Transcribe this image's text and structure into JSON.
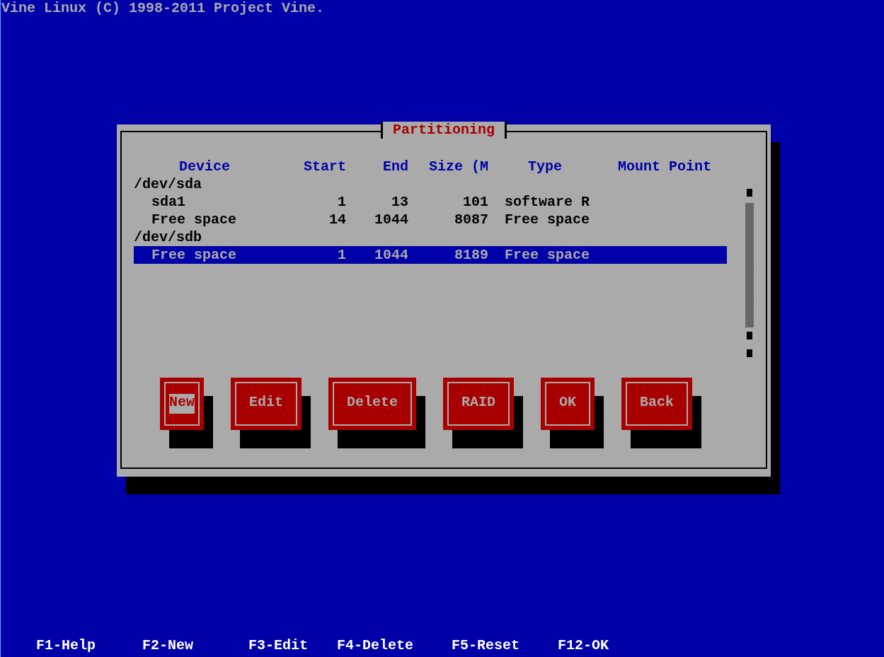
{
  "header": "Vine Linux (C) 1998-2011 Project Vine.",
  "dialog": {
    "title": "Partitioning",
    "columns": [
      "Device",
      "Start",
      "End",
      "Size (M",
      "Type",
      "Mount Point"
    ],
    "disks": [
      {
        "device": "/dev/sda",
        "selected": false,
        "children": [
          {
            "device": "sda1",
            "start": "1",
            "end": "13",
            "size": "101",
            "type": "software R",
            "selected": false
          },
          {
            "device": "Free space",
            "start": "14",
            "end": "1044",
            "size": "8087",
            "type": "Free space",
            "selected": false
          }
        ]
      },
      {
        "device": "/dev/sdb",
        "selected": false,
        "children": [
          {
            "device": "Free space",
            "start": "1",
            "end": "1044",
            "size": "8189",
            "type": "Free space",
            "selected": true
          }
        ]
      }
    ],
    "buttons": [
      {
        "label": "New",
        "selected": true
      },
      {
        "label": "Edit",
        "selected": false
      },
      {
        "label": "Delete",
        "selected": false
      },
      {
        "label": "RAID",
        "selected": false
      },
      {
        "label": "OK",
        "selected": false
      },
      {
        "label": "Back",
        "selected": false
      }
    ]
  },
  "hotkeys": [
    "F1-Help",
    "F2-New",
    "F3-Edit",
    "F4-Delete",
    "F5-Reset",
    "F12-OK"
  ]
}
